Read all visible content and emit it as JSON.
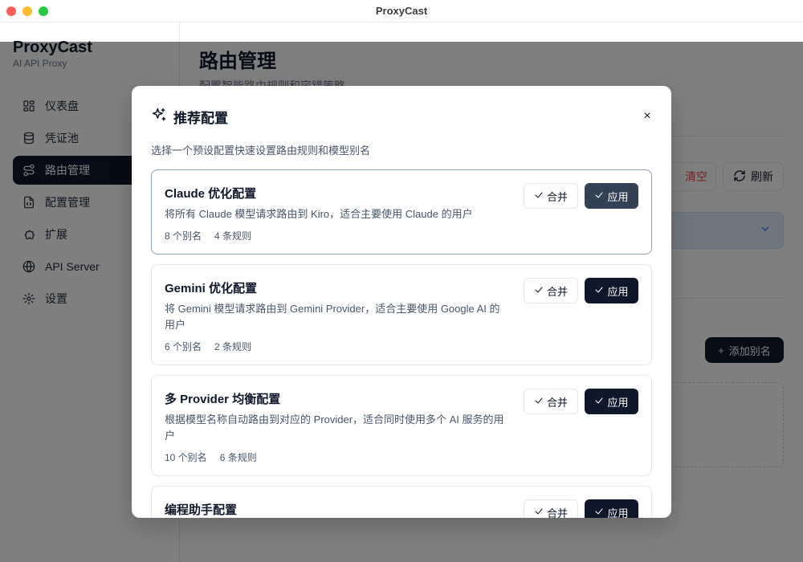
{
  "window": {
    "title": "ProxyCast"
  },
  "sidebar": {
    "brand": "ProxyCast",
    "subtitle": "AI API Proxy",
    "items": [
      {
        "label": "仪表盘",
        "icon": "dashboard-icon"
      },
      {
        "label": "凭证池",
        "icon": "database-icon"
      },
      {
        "label": "路由管理",
        "icon": "route-icon",
        "active": true
      },
      {
        "label": "配置管理",
        "icon": "file-code-icon"
      },
      {
        "label": "扩展",
        "icon": "puzzle-icon"
      },
      {
        "label": "API Server",
        "icon": "globe-icon"
      },
      {
        "label": "设置",
        "icon": "gear-icon"
      }
    ]
  },
  "main": {
    "title": "路由管理",
    "subtitle": "配置智能路由规则和容错策略",
    "clear_label": "清空",
    "refresh_label": "刷新",
    "add_alias_label": "添加别名"
  },
  "modal": {
    "title": "推荐配置",
    "close": "×",
    "description": "选择一个预设配置快速设置路由规则和模型别名",
    "merge_label": "合并",
    "apply_label": "应用",
    "presets": [
      {
        "title": "Claude 优化配置",
        "description": "将所有 Claude 模型请求路由到 Kiro，适合主要使用 Claude 的用户",
        "aliases": "8 个别名",
        "rules": "4 条规则"
      },
      {
        "title": "Gemini 优化配置",
        "description": "将 Gemini 模型请求路由到 Gemini Provider，适合主要使用 Google AI 的用户",
        "aliases": "6 个别名",
        "rules": "2 条规则"
      },
      {
        "title": "多 Provider 均衡配置",
        "description": "根据模型名称自动路由到对应的 Provider，适合同时使用多个 AI 服务的用户",
        "aliases": "10 个别名",
        "rules": "6 条规则"
      },
      {
        "title": "编程助手配置",
        "description": "",
        "aliases": "",
        "rules": ""
      }
    ]
  },
  "colors": {
    "primary": "#0f172a",
    "danger": "#ef4444",
    "muted": "#64748b"
  }
}
